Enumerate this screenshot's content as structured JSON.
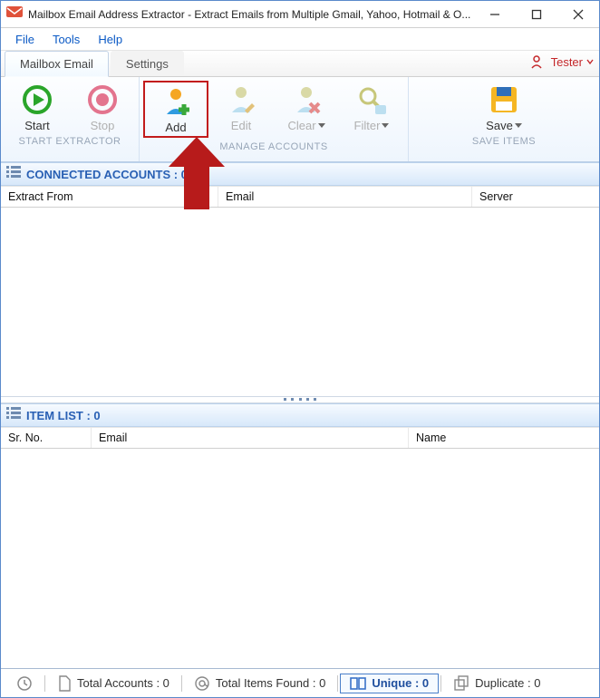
{
  "titlebar": {
    "title": "Mailbox Email Address Extractor - Extract Emails from Multiple Gmail, Yahoo, Hotmail & O..."
  },
  "menubar": {
    "items": [
      "File",
      "Tools",
      "Help"
    ]
  },
  "tabs": {
    "items": [
      "Mailbox Email",
      "Settings"
    ],
    "active": 0
  },
  "user": {
    "label": "Tester"
  },
  "ribbon": {
    "groups": [
      {
        "caption": "START EXTRACTOR",
        "items": [
          {
            "label": "Start",
            "icon": "play-icon",
            "disabled": false
          },
          {
            "label": "Stop",
            "icon": "stop-icon",
            "disabled": true
          }
        ]
      },
      {
        "caption": "MANAGE ACCOUNTS",
        "items": [
          {
            "label": "Add",
            "icon": "add-user-icon",
            "disabled": false,
            "highlighted": true
          },
          {
            "label": "Edit",
            "icon": "edit-user-icon",
            "disabled": true
          },
          {
            "label": "Clear",
            "icon": "clear-user-icon",
            "disabled": true,
            "caret": true
          },
          {
            "label": "Filter",
            "icon": "filter-icon",
            "disabled": true,
            "caret": true
          }
        ]
      },
      {
        "caption": "SAVE ITEMS",
        "items": [
          {
            "label": "Save",
            "icon": "save-icon",
            "disabled": false,
            "caret": true
          }
        ]
      }
    ]
  },
  "connected_section": {
    "title": "CONNECTED ACCOUNTS : 0",
    "columns": [
      "Extract From",
      "Email",
      "Server"
    ]
  },
  "item_section": {
    "title": "ITEM LIST : 0",
    "columns": [
      "Sr. No.",
      "Email",
      "Name"
    ]
  },
  "statusbar": {
    "segments": [
      {
        "icon": "history-icon",
        "text": ""
      },
      {
        "icon": "doc-icon",
        "text": "Total Accounts : 0"
      },
      {
        "icon": "at-icon",
        "text": "Total Items Found : 0"
      },
      {
        "icon": "unique-icon",
        "text": "Unique : 0",
        "active": true
      },
      {
        "icon": "dup-icon",
        "text": "Duplicate : 0"
      }
    ]
  }
}
